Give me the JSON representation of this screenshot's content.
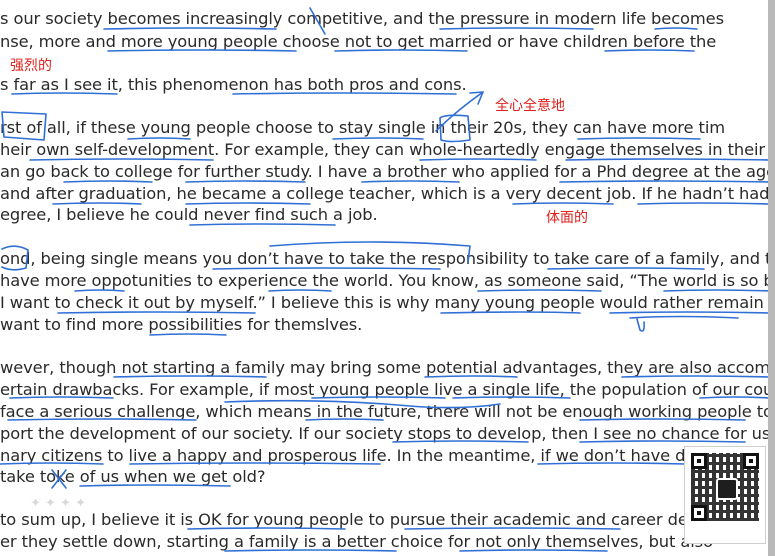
{
  "paragraphs": [
    {
      "lines": [
        "s our society becomes increasingly competitive, and the pressure in modern life becomes",
        "nse, more and more young people choose not to get married or have children before the",
        "s far as I see it, this phenomenon has both pros and cons."
      ]
    },
    {
      "lines": [
        "rst of all, if these young people choose to stay single in their 20s, they can have more tim",
        "heir own self-development. For example, they can whole-heartedly engage themselves in their job",
        "an go back to college for further study. I have a brother who applied for a Phd degree at the age of",
        "and after graduation, he became a college teacher, which is a very decent job. If he hadn’t had su",
        "egree, I believe he could never find such a job."
      ]
    },
    {
      "lines": [
        "ond, being single means you don’t have to take the responsibility to take care of a family, and thus",
        " have more oppotunities to experience the world. You know, as someone said, “The world is so big",
        " I want to check it out by myself.” I believe this is why many young people would rather remain sin",
        " want to find more possibilities for themslves."
      ]
    },
    {
      "lines": [
        "wever, though not starting a family may bring some potential advantages, they are also accompan",
        "ertain drawbacks. For example, if most young people live a single life, the population of our countr",
        "face a serious challenge, which means in the future, there will not be enough working people to",
        "port the development of our society. If our society stops to develop, then I see no chance for us",
        "nary citizens to live a happy and prosperous life. In the meantime, if we don’t have des",
        "take toke of us when we get old?"
      ]
    },
    {
      "lines": [
        "to sum up, I believe it is OK for young people to pursue their academic and career deve",
        "er they settle down, starting a family is a better choice for not only themselves, but also"
      ]
    }
  ],
  "annotations": {
    "note1": "强烈的",
    "note2": "全心全意地",
    "note3": "体面的"
  },
  "colors": {
    "ink": "#2f6fd6",
    "note": "#e0211c",
    "text": "#2a2a2a"
  }
}
